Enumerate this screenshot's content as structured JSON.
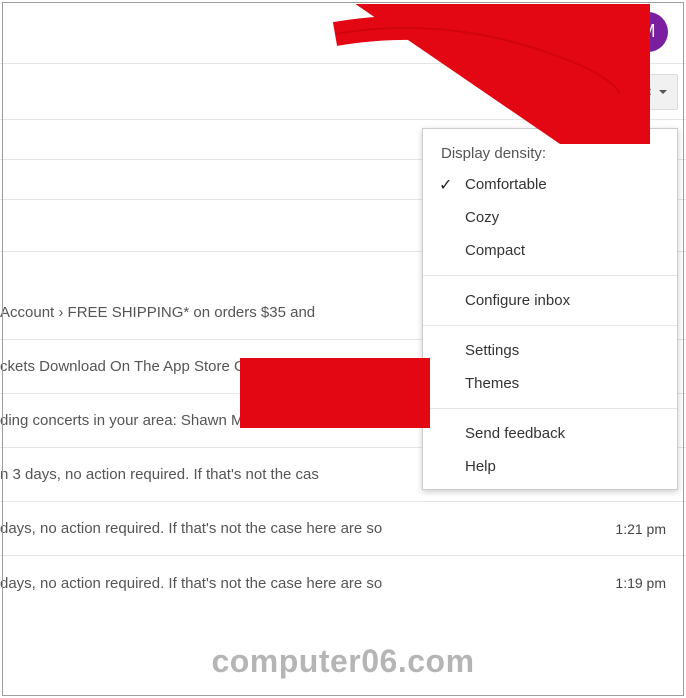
{
  "header": {
    "avatar_initial": "M"
  },
  "dropdown": {
    "title": "Display density:",
    "comfortable": "Comfortable",
    "cozy": "Cozy",
    "compact": "Compact",
    "configure": "Configure inbox",
    "settings": "Settings",
    "themes": "Themes",
    "feedback": "Send feedback",
    "help": "Help"
  },
  "rows": {
    "r1": {
      "snippet": "Account › FREE SHIPPING* on orders $35 and "
    },
    "r2": {
      "snippet": "ckets Download On The App Store Ge"
    },
    "r3": {
      "snippet": "ding concerts in your area: Shawn Mendes and"
    },
    "r4": {
      "snippet": "n 3 days, no action required. If that's not the cas"
    },
    "r5": {
      "snippet": "days, no action required. If that's not the case here are so",
      "time": "1:21 pm"
    },
    "r6": {
      "snippet": "days, no action required. If that's not the case here are so",
      "time": "1:19 pm"
    }
  },
  "watermark": "computer06.com"
}
